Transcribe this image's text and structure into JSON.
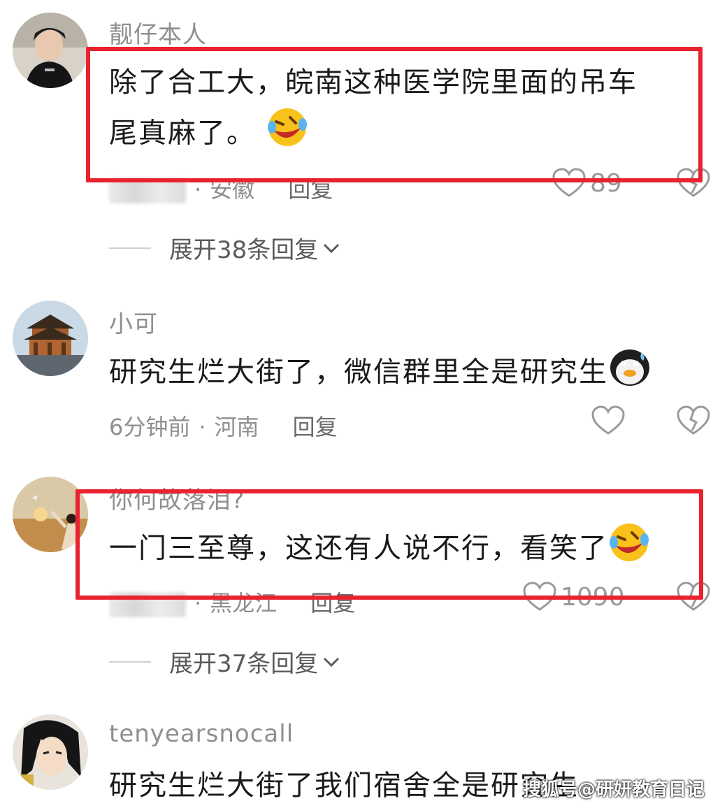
{
  "comments": [
    {
      "username": "靓仔本人",
      "avatar_icon": "person-avatar",
      "text_line1": "除了合工大，皖南这种医学院里面的吊车",
      "text_line2": "尾真麻了。",
      "emoji_icon": "laughing-crying-emoji",
      "location": "安徽",
      "reply_label": "回复",
      "likes": "89",
      "expand_label": "展开38条回复"
    },
    {
      "username": "小可",
      "avatar_icon": "pavilion-avatar",
      "text": "研究生烂大街了，微信群里全是研究生",
      "emoji_icon": "penguin-sweat-emoji",
      "time": "6分钟前",
      "location": "河南",
      "reply_label": "回复"
    },
    {
      "username": "你何故落泪?",
      "avatar_icon": "sunset-avatar",
      "text": "一门三至尊，这还有人说不行，看笑了",
      "emoji_icon": "laughing-crying-emoji",
      "location": "黑龙江",
      "reply_label": "回复",
      "likes": "1090",
      "expand_label": "展开37条回复"
    },
    {
      "username": "tenyearsnocall",
      "avatar_icon": "anime-avatar",
      "text": "研究生烂大街了我们宿舍全是研究生"
    }
  ],
  "separator": "·",
  "watermark": "搜狐号@研妍教育日记",
  "colors": {
    "highlight": "#e8232f",
    "meta_gray": "#8f8f8f"
  }
}
